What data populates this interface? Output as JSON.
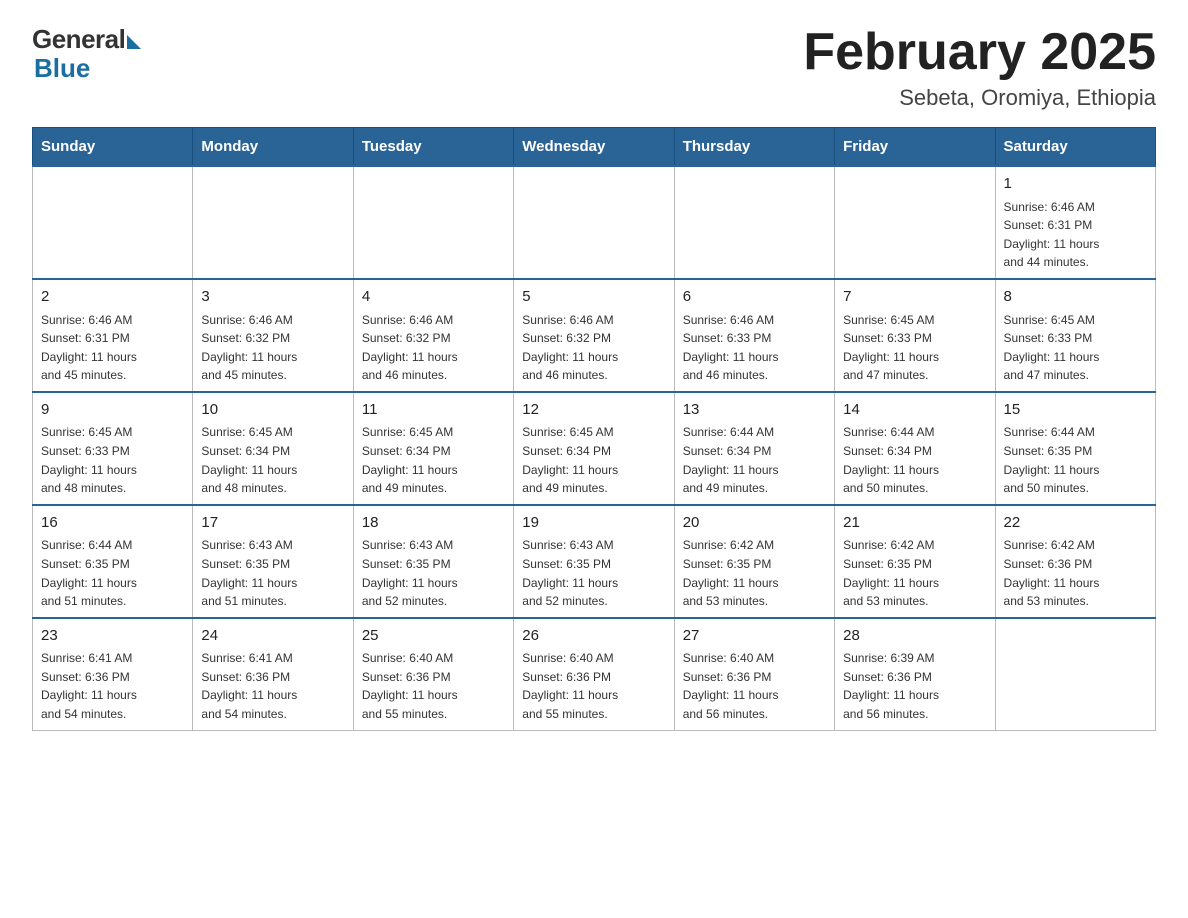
{
  "header": {
    "logo_general": "General",
    "logo_blue": "Blue",
    "title": "February 2025",
    "subtitle": "Sebeta, Oromiya, Ethiopia"
  },
  "days_of_week": [
    "Sunday",
    "Monday",
    "Tuesday",
    "Wednesday",
    "Thursday",
    "Friday",
    "Saturday"
  ],
  "weeks": [
    {
      "days": [
        {
          "number": "",
          "info": ""
        },
        {
          "number": "",
          "info": ""
        },
        {
          "number": "",
          "info": ""
        },
        {
          "number": "",
          "info": ""
        },
        {
          "number": "",
          "info": ""
        },
        {
          "number": "",
          "info": ""
        },
        {
          "number": "1",
          "info": "Sunrise: 6:46 AM\nSunset: 6:31 PM\nDaylight: 11 hours\nand 44 minutes."
        }
      ]
    },
    {
      "days": [
        {
          "number": "2",
          "info": "Sunrise: 6:46 AM\nSunset: 6:31 PM\nDaylight: 11 hours\nand 45 minutes."
        },
        {
          "number": "3",
          "info": "Sunrise: 6:46 AM\nSunset: 6:32 PM\nDaylight: 11 hours\nand 45 minutes."
        },
        {
          "number": "4",
          "info": "Sunrise: 6:46 AM\nSunset: 6:32 PM\nDaylight: 11 hours\nand 46 minutes."
        },
        {
          "number": "5",
          "info": "Sunrise: 6:46 AM\nSunset: 6:32 PM\nDaylight: 11 hours\nand 46 minutes."
        },
        {
          "number": "6",
          "info": "Sunrise: 6:46 AM\nSunset: 6:33 PM\nDaylight: 11 hours\nand 46 minutes."
        },
        {
          "number": "7",
          "info": "Sunrise: 6:45 AM\nSunset: 6:33 PM\nDaylight: 11 hours\nand 47 minutes."
        },
        {
          "number": "8",
          "info": "Sunrise: 6:45 AM\nSunset: 6:33 PM\nDaylight: 11 hours\nand 47 minutes."
        }
      ]
    },
    {
      "days": [
        {
          "number": "9",
          "info": "Sunrise: 6:45 AM\nSunset: 6:33 PM\nDaylight: 11 hours\nand 48 minutes."
        },
        {
          "number": "10",
          "info": "Sunrise: 6:45 AM\nSunset: 6:34 PM\nDaylight: 11 hours\nand 48 minutes."
        },
        {
          "number": "11",
          "info": "Sunrise: 6:45 AM\nSunset: 6:34 PM\nDaylight: 11 hours\nand 49 minutes."
        },
        {
          "number": "12",
          "info": "Sunrise: 6:45 AM\nSunset: 6:34 PM\nDaylight: 11 hours\nand 49 minutes."
        },
        {
          "number": "13",
          "info": "Sunrise: 6:44 AM\nSunset: 6:34 PM\nDaylight: 11 hours\nand 49 minutes."
        },
        {
          "number": "14",
          "info": "Sunrise: 6:44 AM\nSunset: 6:34 PM\nDaylight: 11 hours\nand 50 minutes."
        },
        {
          "number": "15",
          "info": "Sunrise: 6:44 AM\nSunset: 6:35 PM\nDaylight: 11 hours\nand 50 minutes."
        }
      ]
    },
    {
      "days": [
        {
          "number": "16",
          "info": "Sunrise: 6:44 AM\nSunset: 6:35 PM\nDaylight: 11 hours\nand 51 minutes."
        },
        {
          "number": "17",
          "info": "Sunrise: 6:43 AM\nSunset: 6:35 PM\nDaylight: 11 hours\nand 51 minutes."
        },
        {
          "number": "18",
          "info": "Sunrise: 6:43 AM\nSunset: 6:35 PM\nDaylight: 11 hours\nand 52 minutes."
        },
        {
          "number": "19",
          "info": "Sunrise: 6:43 AM\nSunset: 6:35 PM\nDaylight: 11 hours\nand 52 minutes."
        },
        {
          "number": "20",
          "info": "Sunrise: 6:42 AM\nSunset: 6:35 PM\nDaylight: 11 hours\nand 53 minutes."
        },
        {
          "number": "21",
          "info": "Sunrise: 6:42 AM\nSunset: 6:35 PM\nDaylight: 11 hours\nand 53 minutes."
        },
        {
          "number": "22",
          "info": "Sunrise: 6:42 AM\nSunset: 6:36 PM\nDaylight: 11 hours\nand 53 minutes."
        }
      ]
    },
    {
      "days": [
        {
          "number": "23",
          "info": "Sunrise: 6:41 AM\nSunset: 6:36 PM\nDaylight: 11 hours\nand 54 minutes."
        },
        {
          "number": "24",
          "info": "Sunrise: 6:41 AM\nSunset: 6:36 PM\nDaylight: 11 hours\nand 54 minutes."
        },
        {
          "number": "25",
          "info": "Sunrise: 6:40 AM\nSunset: 6:36 PM\nDaylight: 11 hours\nand 55 minutes."
        },
        {
          "number": "26",
          "info": "Sunrise: 6:40 AM\nSunset: 6:36 PM\nDaylight: 11 hours\nand 55 minutes."
        },
        {
          "number": "27",
          "info": "Sunrise: 6:40 AM\nSunset: 6:36 PM\nDaylight: 11 hours\nand 56 minutes."
        },
        {
          "number": "28",
          "info": "Sunrise: 6:39 AM\nSunset: 6:36 PM\nDaylight: 11 hours\nand 56 minutes."
        },
        {
          "number": "",
          "info": ""
        }
      ]
    }
  ]
}
